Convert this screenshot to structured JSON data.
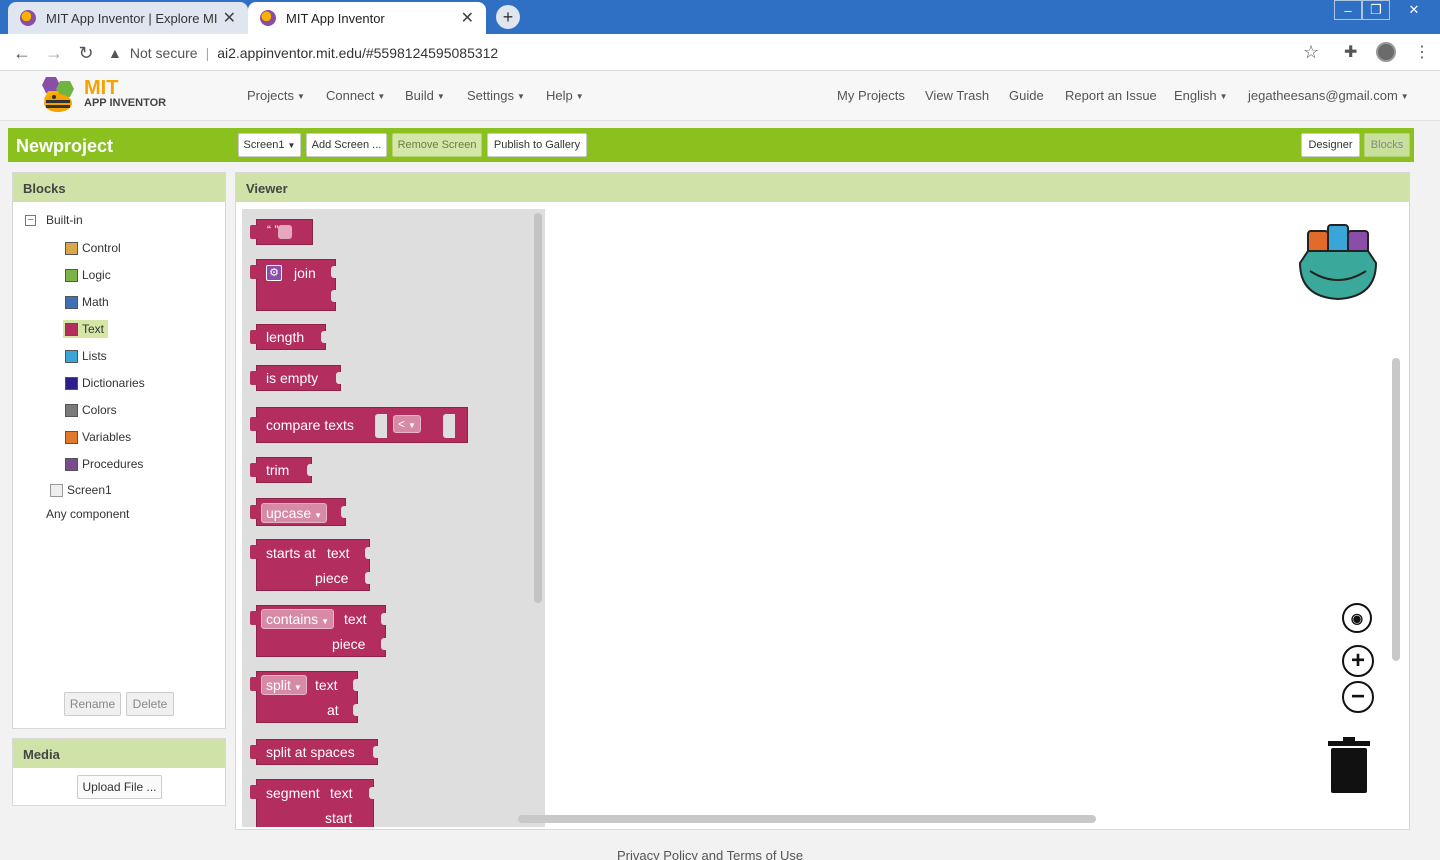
{
  "browser": {
    "tabs": [
      {
        "title": "MIT App Inventor | Explore MIT A"
      },
      {
        "title": "MIT App Inventor"
      }
    ],
    "new_tab": "+",
    "address": {
      "security": "Not secure",
      "url": "ai2.appinventor.mit.edu/#5598124595085312"
    }
  },
  "header": {
    "logo_line1": "MIT",
    "logo_line2": "APP INVENTOR",
    "menus": [
      "Projects",
      "Connect",
      "Build",
      "Settings",
      "Help"
    ],
    "links": [
      "My Projects",
      "View Trash",
      "Guide",
      "Report an Issue",
      "English"
    ],
    "account": "jegatheesans@gmail.com"
  },
  "project": {
    "name": "Newproject",
    "screen_select": "Screen1",
    "add_screen": "Add Screen ...",
    "remove_screen": "Remove Screen",
    "publish": "Publish to Gallery",
    "designer": "Designer",
    "blocks": "Blocks"
  },
  "blocks_panel": {
    "title": "Blocks",
    "builtin": "Built-in",
    "categories": [
      {
        "label": "Control",
        "color": "#d8a84a"
      },
      {
        "label": "Logic",
        "color": "#7bb347"
      },
      {
        "label": "Math",
        "color": "#3f70b6"
      },
      {
        "label": "Text",
        "color": "#b32d5e"
      },
      {
        "label": "Lists",
        "color": "#3aa5d6"
      },
      {
        "label": "Dictionaries",
        "color": "#2d1f8a"
      },
      {
        "label": "Colors",
        "color": "#7a7a7a"
      },
      {
        "label": "Variables",
        "color": "#e07a2a"
      },
      {
        "label": "Procedures",
        "color": "#7a4b8f"
      }
    ],
    "screen": "Screen1",
    "any_component": "Any component",
    "rename": "Rename",
    "delete": "Delete"
  },
  "media": {
    "title": "Media",
    "upload": "Upload File ..."
  },
  "viewer": {
    "title": "Viewer",
    "blocks": {
      "quote": "“ ”",
      "join": "join",
      "length": "length",
      "is_empty": "is empty",
      "compare": "compare texts",
      "compare_op": "<",
      "trim": "trim",
      "upcase": "upcase",
      "starts_at": "starts at",
      "text": "text",
      "piece": "piece",
      "contains": "contains",
      "split": "split",
      "at": "at",
      "split_spaces": "split at spaces",
      "segment": "segment",
      "start": "start"
    }
  },
  "footer": {
    "text": "Privacy Policy and Terms of Use"
  }
}
